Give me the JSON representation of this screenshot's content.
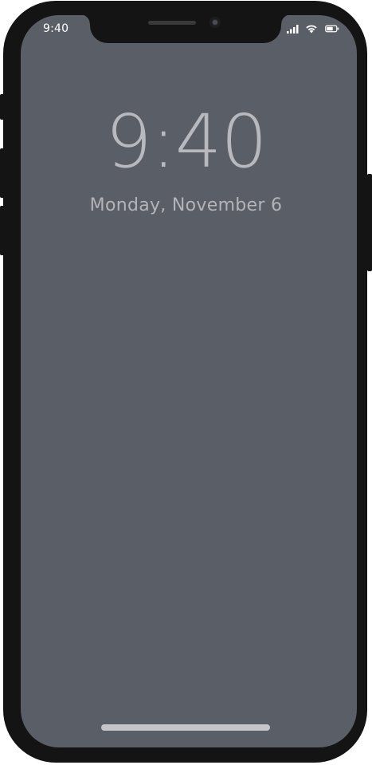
{
  "status_bar": {
    "time": "9:40",
    "icons": [
      "cellular-signal-icon",
      "wifi-icon",
      "battery-icon"
    ]
  },
  "lock_screen": {
    "time": "9:40",
    "date": "Monday, November 6"
  },
  "colors": {
    "frame": "#141414",
    "screen": "#5a5e66",
    "clock_text": "#b7b9be",
    "home_indicator": "#c5c6ca"
  }
}
